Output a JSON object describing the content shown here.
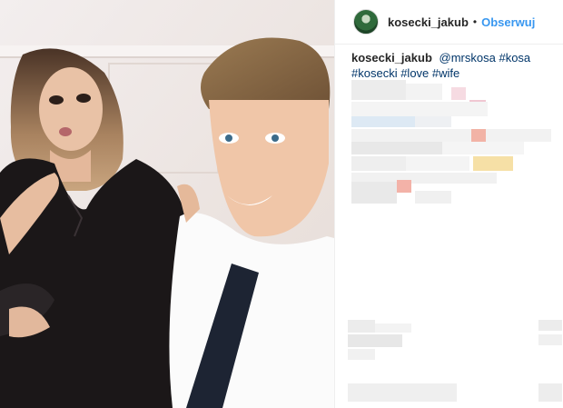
{
  "post": {
    "username": "kosecki_jakub",
    "separator": "•",
    "follow_label": "Obserwuj"
  },
  "caption": {
    "author": "kosecki_jakub",
    "tags": [
      "@mrskosa",
      "#kosa",
      "#kosecki",
      "#love",
      "#wife"
    ]
  },
  "colors": {
    "follow": "#3897f0",
    "tag": "#003569"
  }
}
